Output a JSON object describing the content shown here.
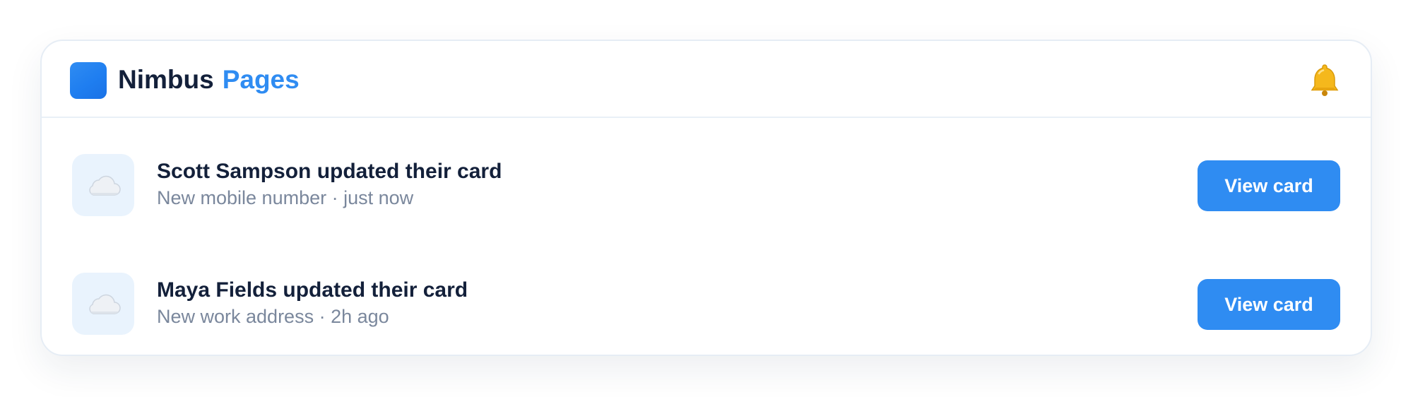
{
  "header": {
    "brand_name": "Nimbus",
    "brand_product": "Pages",
    "logo_icon": "app-logo-square",
    "bell_icon": "bell-icon"
  },
  "notifications": [
    {
      "icon": "cloud-icon",
      "title": "Scott Sampson updated their card",
      "subtitle": "New mobile number · just now",
      "button_label": "View card"
    },
    {
      "icon": "cloud-icon",
      "title": "Maya Fields updated their card",
      "subtitle": "New work address · 2h ago",
      "button_label": "View card"
    }
  ],
  "colors": {
    "accent": "#2f8cf2",
    "title_text": "#13203a",
    "muted_text": "#7a879c",
    "thumb_bg": "#e9f3fd",
    "bell": "#f5b81c"
  }
}
